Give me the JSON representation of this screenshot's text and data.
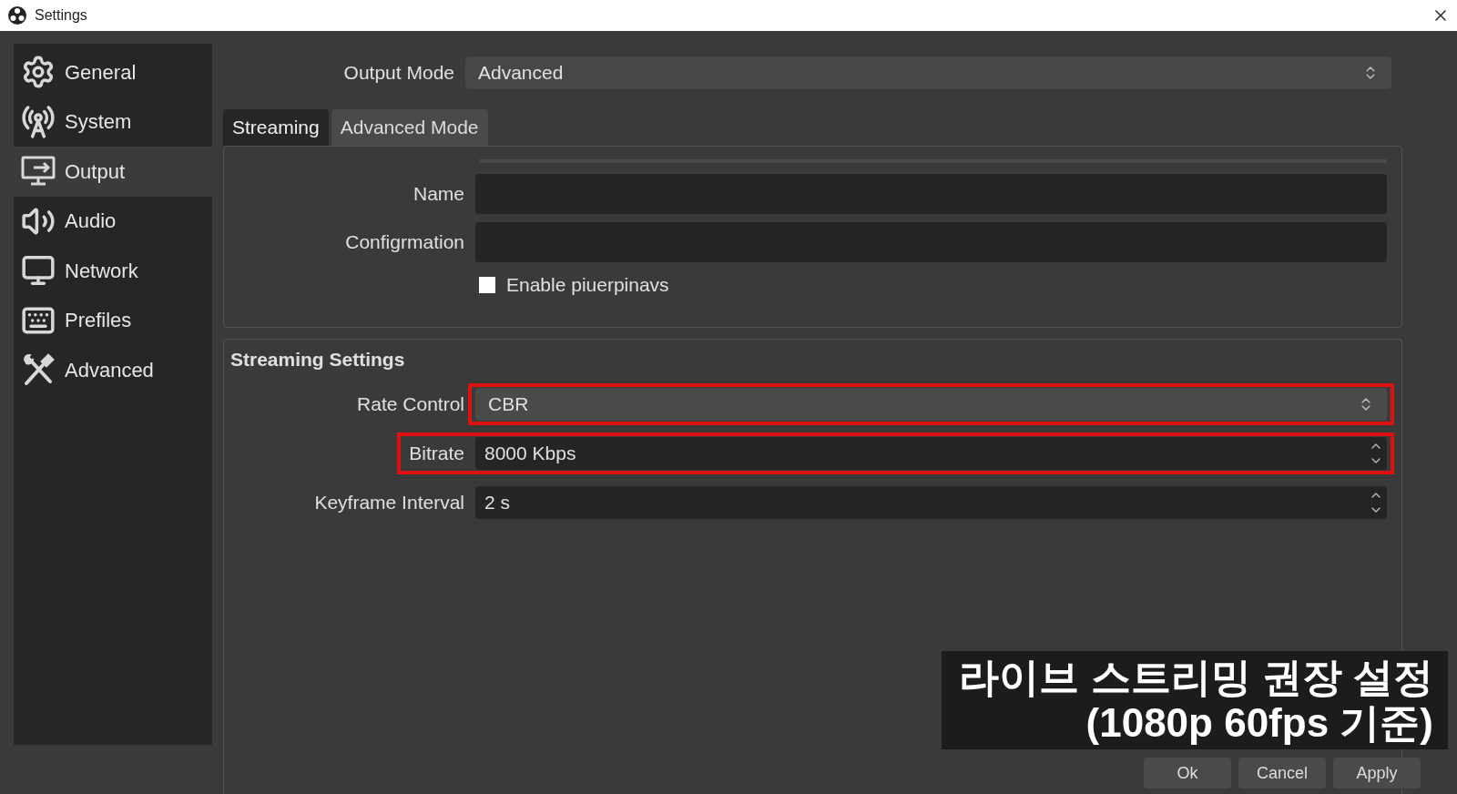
{
  "window": {
    "title": "Settings"
  },
  "sidebar": {
    "items": [
      {
        "kind": "gear",
        "label": "General",
        "selected": false
      },
      {
        "kind": "antenna",
        "label": "System",
        "selected": false
      },
      {
        "kind": "output",
        "label": "Output",
        "selected": true
      },
      {
        "kind": "speaker",
        "label": "Audio",
        "selected": false
      },
      {
        "kind": "monitor",
        "label": "Network",
        "selected": false
      },
      {
        "kind": "keyboard",
        "label": "Prefiles",
        "selected": false
      },
      {
        "kind": "tools",
        "label": "Advanced",
        "selected": false
      }
    ]
  },
  "output_mode": {
    "label": "Output Mode",
    "value": "Advanced"
  },
  "tabs": [
    {
      "label": "Streaming",
      "selected": true
    },
    {
      "label": "Advanced Mode",
      "selected": false
    }
  ],
  "encoder_group": {
    "fields": [
      {
        "label": "Name"
      },
      {
        "label": "Configrmation"
      }
    ],
    "checkbox": {
      "label": "Enable piuerpinavs",
      "checked": false
    }
  },
  "streaming_settings": {
    "title": "Streaming Settings",
    "fields": [
      {
        "kind": "dropdown",
        "label": "Rate Control",
        "value": "CBR",
        "highlighted": true
      },
      {
        "kind": "spinbox",
        "label": "Bitrate",
        "value": "8000 Kbps",
        "highlighted": true
      },
      {
        "kind": "spinbox",
        "label": "Keyframe Interval",
        "value": "2 s",
        "highlighted": false
      }
    ]
  },
  "buttons": [
    "Ok",
    "Cancel",
    "Apply"
  ],
  "caption": {
    "lines": [
      "라이브 스트리밍 권장 설정",
      "(1080p 60fps 기준)"
    ]
  }
}
